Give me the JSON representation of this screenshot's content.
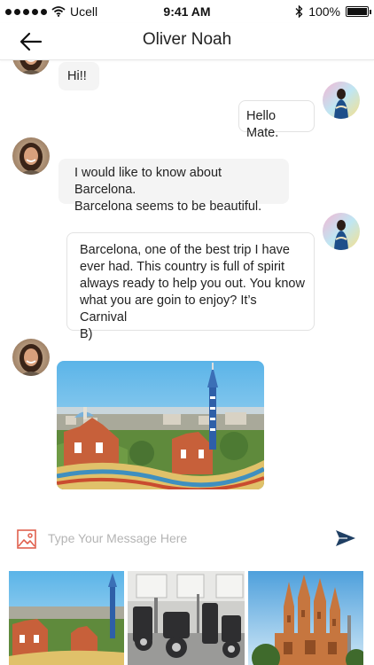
{
  "status_bar": {
    "carrier": "Ucell",
    "time": "9:41 AM",
    "battery": "100%",
    "icons": [
      "signal-dots-icon",
      "wifi-icon",
      "bluetooth-icon",
      "battery-icon"
    ]
  },
  "header": {
    "title": "Oliver Noah",
    "back_icon": "back-arrow-icon"
  },
  "messages": [
    {
      "direction": "incoming",
      "type": "text",
      "text": "Hi!!"
    },
    {
      "direction": "outgoing",
      "type": "text",
      "text": "Hello Mate."
    },
    {
      "direction": "incoming",
      "type": "text",
      "lines": [
        "I would like to know about Barcelona.",
        "Barcelona seems to be beautiful."
      ]
    },
    {
      "direction": "outgoing",
      "type": "text",
      "lines": [
        "Barcelona, one of the best trip I have",
        "ever had. This country is full of spirit",
        "always ready to help you out. You know",
        "what you are goin to enjoy? It’s Carnival",
        "B)"
      ]
    },
    {
      "direction": "incoming",
      "type": "image",
      "image": "park-guell-photo"
    }
  ],
  "composer": {
    "placeholder": "Type Your Message Here",
    "value": "",
    "image_icon": "image-icon",
    "send_icon": "send-icon"
  },
  "gallery": {
    "items": [
      "park-guell-thumb",
      "gym-equipment-thumb",
      "sagrada-familia-thumb"
    ]
  },
  "colors": {
    "accent": "#1f3f63",
    "image_icon": "#e0604e",
    "bubble_incoming": "#f4f4f4",
    "bubble_outgoing_border": "#e2e2e2"
  }
}
